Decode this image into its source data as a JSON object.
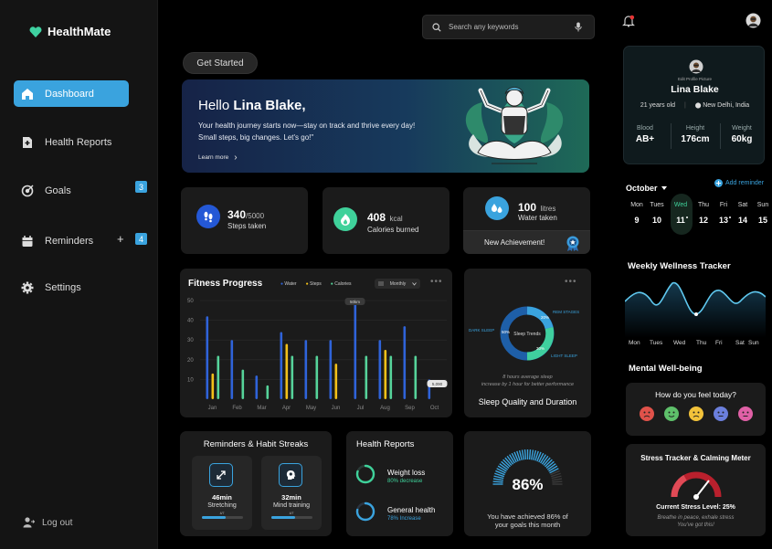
{
  "app": {
    "name": "HealthMate"
  },
  "sidebar": {
    "items": [
      {
        "label": "Dashboard",
        "icon": "home-icon"
      },
      {
        "label": "Health Reports",
        "icon": "document-plus-icon"
      },
      {
        "label": "Goals",
        "icon": "target-icon",
        "badge": "3"
      },
      {
        "label": "Reminders",
        "icon": "calendar-icon",
        "badge": "4",
        "extra": "+"
      },
      {
        "label": "Settings",
        "icon": "gear-icon"
      }
    ],
    "logout": "Log out"
  },
  "search": {
    "placeholder": "Search any keywords"
  },
  "get_started": "Get Started",
  "hero": {
    "greeting": "Hello ",
    "name": "Lina Blake,",
    "line1": "Your health journey starts now—stay on track and thrive every day!",
    "line2": "Small steps, big changes. Let's go!\"",
    "learn_more": "Learn more",
    "learn_arrow": "›"
  },
  "stats": {
    "steps": {
      "value": "340",
      "unit": "/5000",
      "label": "Steps taken"
    },
    "calories": {
      "value": "408",
      "unit": "kcal",
      "label": "Calories burned"
    },
    "water": {
      "value": "100",
      "unit": "litres",
      "label": "Water taken"
    },
    "achievement": "New Achievement!"
  },
  "fitness": {
    "title": "Fitness Progress",
    "legend": [
      "Water",
      "Steps",
      "Calories"
    ],
    "period": "Monthly",
    "menu": "•••",
    "tooltip_top": "50km",
    "tooltip_right": "5,090"
  },
  "chart_data": {
    "type": "bar",
    "categories": [
      "Jan",
      "Feb",
      "Mar",
      "Apr",
      "May",
      "Jun",
      "Jul",
      "Aug",
      "Sep",
      "Oct"
    ],
    "ylim": [
      0,
      50
    ],
    "yticks": [
      10,
      20,
      30,
      40,
      50
    ],
    "grid": true,
    "legend_position": "top",
    "series": [
      {
        "name": "Water",
        "color": "#2f63d9",
        "values": [
          42,
          30,
          12,
          34,
          30,
          30,
          49,
          30,
          37,
          10
        ]
      },
      {
        "name": "Steps",
        "color": "#f2c019",
        "values": [
          13,
          0,
          0,
          28,
          0,
          18,
          0,
          25,
          0,
          0
        ]
      },
      {
        "name": "Calories",
        "color": "#56d39a",
        "values": [
          22,
          15,
          7,
          22,
          22,
          0,
          22,
          22,
          22,
          0
        ]
      }
    ]
  },
  "sleep": {
    "menu": "•••",
    "labels": {
      "rem": "REM STAGES",
      "dark": "DARK SLEEP",
      "light": "LIGHT SLEEP",
      "center": "Sleep Trends"
    },
    "percent": [
      "20%",
      "50%",
      "30%"
    ],
    "caption1": "8 hours average sleep",
    "caption2": "increase by 1 hour for better performance",
    "title": "Sleep Quality and Duration"
  },
  "habits": {
    "title": "Reminders & Habit Streaks",
    "items": [
      {
        "time": "46min",
        "label": "Stretching",
        "value": "4/7",
        "progress": 0.57
      },
      {
        "time": "32min",
        "label": "Mind training",
        "value": "4/7",
        "progress": 0.57
      }
    ]
  },
  "reports": {
    "title": "Health Reports",
    "items": [
      {
        "label": "Weight loss",
        "sub": "80% decrease",
        "progress": 0.8
      },
      {
        "label": "General health",
        "sub": "78% Increase",
        "progress": 0.78
      }
    ]
  },
  "goals": {
    "percent": "86%",
    "progress": 0.86,
    "caption1": "You have achieved 86% of",
    "caption2": "your goals this month"
  },
  "profile": {
    "edit": "Edit Profile Picture",
    "name": "Lina Blake",
    "age": "21 years old",
    "location": "New Delhi, India",
    "blood_label": "Blood",
    "blood": "AB+",
    "height_label": "Height",
    "height": "176cm",
    "weight_label": "Weight",
    "weight": "60kg"
  },
  "calendar": {
    "month": "October",
    "add": "Add reminder",
    "days": [
      {
        "d": "Mon",
        "n": "9"
      },
      {
        "d": "Tues",
        "n": "10"
      },
      {
        "d": "Wed",
        "n": "11",
        "active": true,
        "dot": true
      },
      {
        "d": "Thu",
        "n": "12"
      },
      {
        "d": "Fri",
        "n": "13",
        "dot": true
      },
      {
        "d": "Sat",
        "n": "14"
      },
      {
        "d": "Sun",
        "n": "15"
      }
    ]
  },
  "wellness": {
    "title": "Weekly Wellness Tracker",
    "days": [
      "Mon",
      "Tues",
      "Wed",
      "Thu",
      "Fri",
      "Sat",
      "Sun"
    ]
  },
  "mental": {
    "title": "Mental Well-being",
    "question": "How do you feel today?",
    "moods": [
      "#e0524a",
      "#5ec06a",
      "#f2c23a",
      "#6b7fdc",
      "#e060a6"
    ]
  },
  "stress": {
    "title": "Stress Tracker & Calming Meter",
    "level": "Current Stress Level: 25%",
    "quote1": "Breathe in peace, exhale stress",
    "quote2": "You've got this!"
  }
}
